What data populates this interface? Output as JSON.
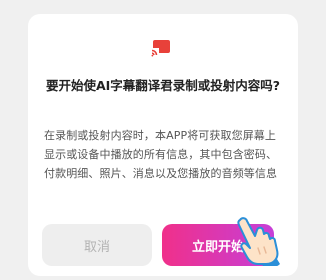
{
  "dialog": {
    "title": "要开始使AI字幕翻译君录制或投射内容吗?",
    "body": "在录制或投射内容时，本APP将可获取您屏幕上显示或设备中播放的所有信息，其中包含密码、付款明细、照片、消息以及您播放的音频等信息",
    "cancel_label": "取消",
    "start_label": "立即开始"
  },
  "icons": {
    "cast": "cast-icon",
    "hand": "tap-hand-icon"
  },
  "colors": {
    "cast_icon": "#e8413a",
    "start_gradient_start": "#f0308a",
    "start_gradient_end": "#c63fd8",
    "cancel_bg": "#eeeeee"
  }
}
